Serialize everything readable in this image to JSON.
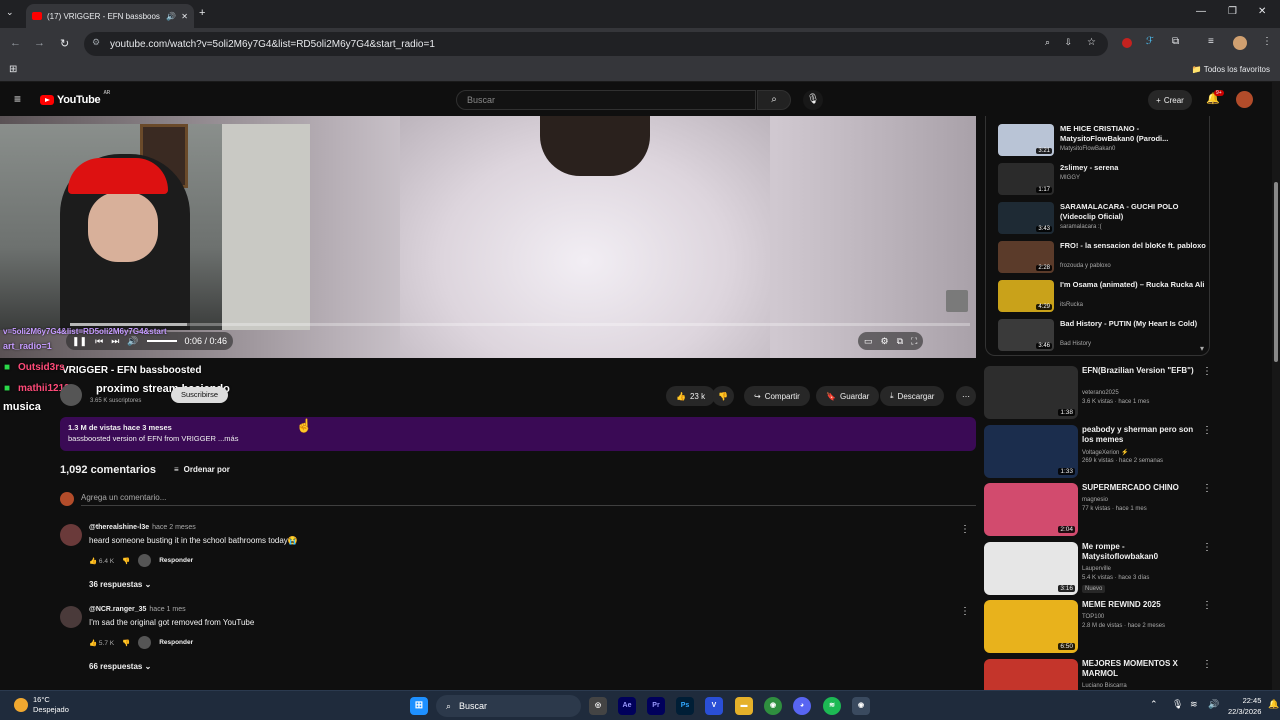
{
  "browser": {
    "tab_title": "(17) VRIGGER - EFN bassboos",
    "url": "youtube.com/watch?v=5oli2M6y7G4&list=RD5oli2M6y7G4&start_radio=1",
    "all_bookmarks": "Todos los favoritos"
  },
  "yt": {
    "logo": "YouTube",
    "logo_country": "AR",
    "search_placeholder": "Buscar",
    "create": "Crear",
    "notif_count": "9+"
  },
  "player": {
    "time": "0:06 / 0:46",
    "progress": 0.13
  },
  "overlay": {
    "url_fragment1": "v=5oli2M6y7G4&list=RD5oli2M6y7G4&start",
    "url_fragment2": "art_radio=1",
    "title_fragment": "VRIGGER - EFN bassboosted",
    "user1": "Outsid3rs",
    "user2": "mathii1212",
    "msg1": "proximo stream haciendo",
    "msg2": "musica"
  },
  "channel": {
    "subs": "3.65 K suscriptores",
    "subscribe": "Suscribirse",
    "likes": "23 k",
    "share": "Compartir",
    "save": "Guardar",
    "download": "Descargar"
  },
  "description": {
    "meta": "1.3 M de vistas  hace 3 meses",
    "text": "bassboosted version of EFN from VRIGGER ...más"
  },
  "comments": {
    "count": "1,092 comentarios",
    "sort": "Ordenar por",
    "add": "Agrega un comentario...",
    "items": [
      {
        "author": "@therealshine-l3e",
        "time": "hace 2 meses",
        "text": "heard someone busting it in the school bathrooms today😭",
        "likes": "6.4 K",
        "reply": "Responder",
        "replies": "36 respuestas"
      },
      {
        "author": "@NCR.ranger_35",
        "time": "hace 1 mes",
        "text": "I'm sad the original got removed from YouTube",
        "likes": "5.7 K",
        "reply": "Responder",
        "replies": "66 respuestas"
      }
    ]
  },
  "playlist": [
    {
      "title": "ME HICE CRISTIANO - MatysitoFlowBakan0 (Parodi...",
      "sub": "MatysitoFlowBakan0",
      "dur": "3:21",
      "color": "#b9c4d6"
    },
    {
      "title": "2slimey - serena",
      "sub": "MIGGY",
      "dur": "1:17",
      "color": "#2b2b2b"
    },
    {
      "title": "SARAMALACARA - GUCHI POLO (Videoclip Oficial)",
      "sub": "saramalacara :(",
      "dur": "3:43",
      "color": "#1e2a34"
    },
    {
      "title": "FRO! - la sensacion del bloKe ft. pabloxo",
      "sub": "frozouda y pabloxo",
      "dur": "2:28",
      "color": "#5b3b2a"
    },
    {
      "title": "I'm Osama (animated) – Rucka Rucka Ali",
      "sub": "itsRucka",
      "dur": "4:29",
      "color": "#c9a21a"
    },
    {
      "title": "Bad History - PUTIN (My Heart Is Cold)",
      "sub": "Bad History",
      "dur": "3:46",
      "color": "#3a3a3a"
    }
  ],
  "recs": [
    {
      "title": "EFN(Brazilian Version \"EFB\")",
      "ch": "veterano2025",
      "meta": "3.6 K vistas · hace 1 mes",
      "dur": "1:38",
      "color": "#2d2d2d",
      "badge": ""
    },
    {
      "title": "peabody y sherman pero son los memes",
      "ch": "VoltageXerion ⚡",
      "meta": "269 k vistas · hace 2 semanas",
      "dur": "1:33",
      "color": "#1b2d4d",
      "badge": ""
    },
    {
      "title": "SUPERMERCADO CHINO",
      "ch": "magnesio",
      "meta": "77 k vistas · hace 1 mes",
      "dur": "2:04",
      "color": "#d24b6e",
      "badge": ""
    },
    {
      "title": "Me rompe - Matysitoflowbakan0",
      "ch": "Lauperville",
      "meta": "5.4 K vistas · hace 3 días",
      "dur": "3:16",
      "color": "#e6e6e6",
      "badge": "Nuevo"
    },
    {
      "title": "MEME REWIND 2025",
      "ch": "TOP100",
      "meta": "2.8 M de vistas · hace 2 meses",
      "dur": "6:50",
      "color": "#e8b21c",
      "badge": ""
    },
    {
      "title": "MEJORES MOMENTOS X MARMOL",
      "ch": "Luciano Biscarra",
      "meta": "",
      "dur": "",
      "color": "#c4352b",
      "badge": ""
    }
  ],
  "taskbar": {
    "temp": "16°C",
    "weather": "Despejado",
    "search": "Buscar",
    "time": "22:45",
    "date": "22/3/2026"
  },
  "icons": {
    "back": "back-arrow-icon",
    "forward": "forward-arrow-icon",
    "reload": "reload-icon"
  }
}
